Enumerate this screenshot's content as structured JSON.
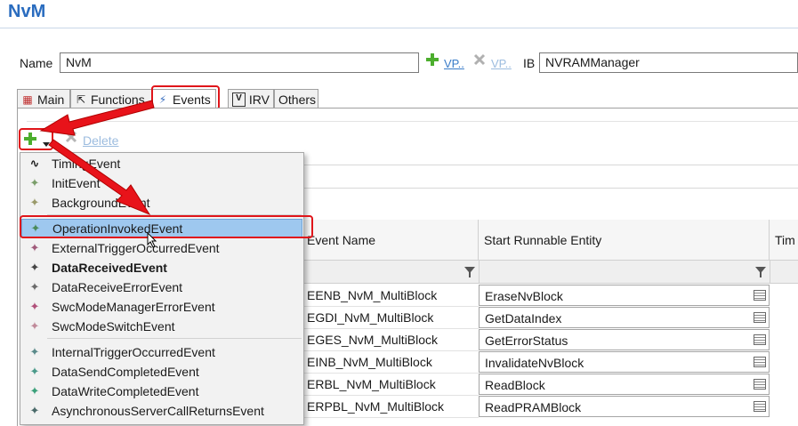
{
  "page_title": "NvM",
  "name_label": "Name",
  "name_value": "NvM",
  "vp_add_label": "VP..",
  "vp_remove_label": "VP..",
  "ib_label": "IB",
  "ib_value": "NVRAMManager",
  "tabs": [
    {
      "label": "Main",
      "icon": "main-icon"
    },
    {
      "label": "Functions",
      "icon": "functions-icon"
    },
    {
      "label": "Events",
      "icon": "events-icon",
      "active": true
    },
    {
      "label": "IRV",
      "icon": "irv-icon"
    },
    {
      "label": "Others"
    }
  ],
  "toolbar": {
    "delete_label": "Delete"
  },
  "table": {
    "columns": [
      "Event Name",
      "Start Runnable Entity",
      "Tim"
    ],
    "rows": [
      {
        "event": "EENB_NvM_MultiBlock",
        "runnable": "EraseNvBlock"
      },
      {
        "event": "EGDI_NvM_MultiBlock",
        "runnable": "GetDataIndex"
      },
      {
        "event": "EGES_NvM_MultiBlock",
        "runnable": "GetErrorStatus"
      },
      {
        "event": "EINB_NvM_MultiBlock",
        "runnable": "InvalidateNvBlock"
      },
      {
        "event": "ERBL_NvM_MultiBlock",
        "runnable": "ReadBlock"
      },
      {
        "event": "ERPBL_NvM_MultiBlock",
        "runnable": "ReadPRAMBlock"
      }
    ]
  },
  "menu": {
    "items": [
      {
        "label": "TimingEvent",
        "icon": "timing-icon"
      },
      {
        "label": "InitEvent",
        "icon": "init-icon"
      },
      {
        "label": "BackgroundEvent",
        "icon": "background-icon"
      },
      {
        "label": "OperationInvokedEvent",
        "icon": "operation-icon",
        "selected": true
      },
      {
        "label": "ExternalTriggerOccurredEvent",
        "icon": "trigger-icon"
      },
      {
        "label": "DataReceivedEvent",
        "icon": "data-received-icon",
        "bold": true
      },
      {
        "label": "DataReceiveErrorEvent",
        "icon": "receive-error-icon"
      },
      {
        "label": "SwcModeManagerErrorEvent",
        "icon": "mode-manager-icon"
      },
      {
        "label": "SwcModeSwitchEvent",
        "icon": "mode-switch-icon"
      },
      {
        "label": "InternalTriggerOccurredEvent",
        "icon": "internal-trigger-icon"
      },
      {
        "label": "DataSendCompletedEvent",
        "icon": "send-completed-icon"
      },
      {
        "label": "DataWriteCompletedEvent",
        "icon": "write-completed-icon"
      },
      {
        "label": "AsynchronousServerCallReturnsEvent",
        "icon": "async-icon"
      }
    ]
  },
  "colors": {
    "accent": "#2a6cbf",
    "highlight": "#e0151a",
    "selection": "#9ec8ef"
  }
}
